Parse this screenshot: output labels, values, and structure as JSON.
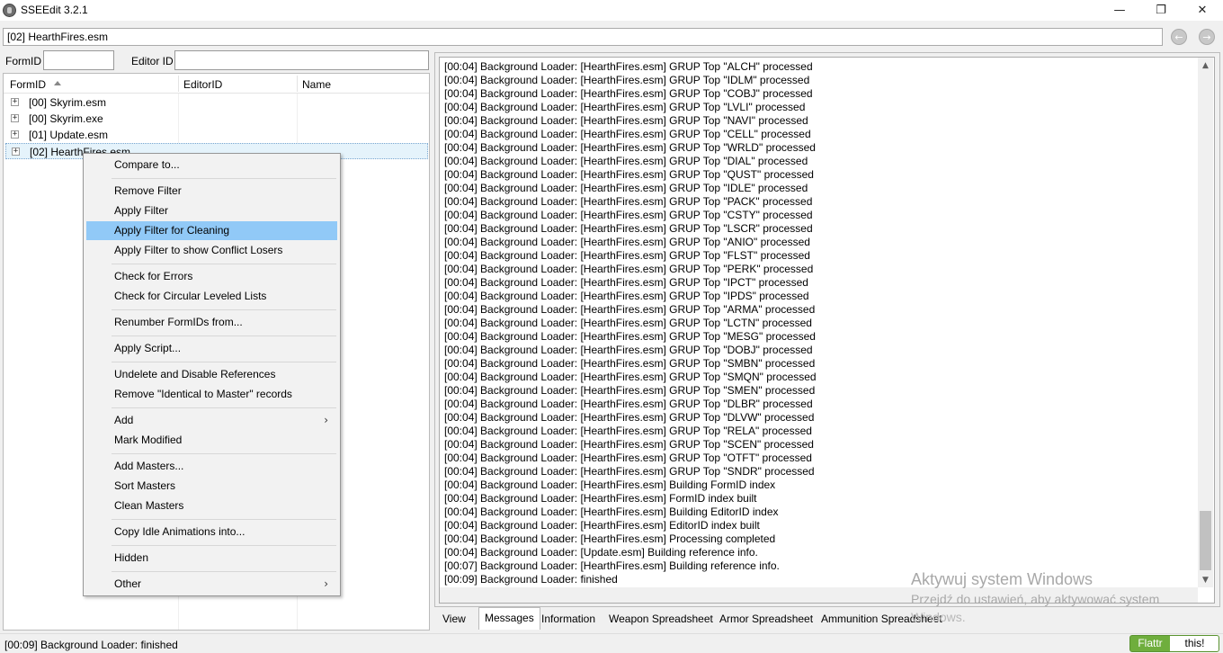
{
  "window": {
    "title": "SSEEdit 3.2.1",
    "minimize_glyph": "—",
    "maximize_glyph": "❐",
    "close_glyph": "✕"
  },
  "path_bar": {
    "value": "[02] HearthFires.esm"
  },
  "nav": {
    "back_glyph": "←",
    "forward_glyph": "→"
  },
  "filter": {
    "formid_label": "FormID",
    "formid_value": "",
    "editorid_label": "Editor ID",
    "editorid_value": ""
  },
  "tree": {
    "columns": [
      "FormID",
      "EditorID",
      "Name"
    ],
    "sort_column": "FormID",
    "sort_direction": "ascending",
    "expander_glyph": "+",
    "rows": [
      {
        "label": "[00] Skyrim.esm",
        "selected": false
      },
      {
        "label": "[00] Skyrim.exe",
        "selected": false
      },
      {
        "label": "[01] Update.esm",
        "selected": false
      },
      {
        "label": "[02] HearthFires.esm",
        "selected": true
      }
    ]
  },
  "context_menu": {
    "items": [
      {
        "label": "Compare to...",
        "separator_after": true
      },
      {
        "label": "Remove Filter"
      },
      {
        "label": "Apply Filter"
      },
      {
        "label": "Apply Filter for Cleaning",
        "highlighted": true
      },
      {
        "label": "Apply Filter to show Conflict Losers",
        "separator_after": true
      },
      {
        "label": "Check for Errors"
      },
      {
        "label": "Check for Circular Leveled Lists",
        "separator_after": true
      },
      {
        "label": "Renumber FormIDs from...",
        "separator_after": true
      },
      {
        "label": "Apply Script...",
        "separator_after": true
      },
      {
        "label": "Undelete and Disable References"
      },
      {
        "label": "Remove \"Identical to Master\" records",
        "separator_after": true
      },
      {
        "label": "Add",
        "submenu": true
      },
      {
        "label": "Mark Modified",
        "separator_after": true
      },
      {
        "label": "Add Masters..."
      },
      {
        "label": "Sort Masters"
      },
      {
        "label": "Clean Masters",
        "separator_after": true
      },
      {
        "label": "Copy Idle Animations into...",
        "separator_after": true
      },
      {
        "label": "Hidden",
        "separator_after": true
      },
      {
        "label": "Other",
        "submenu": true
      }
    ],
    "submenu_glyph": "›"
  },
  "messages": [
    "[00:04] Background Loader: [HearthFires.esm] GRUP Top \"ALCH\" processed",
    "[00:04] Background Loader: [HearthFires.esm] GRUP Top \"IDLM\" processed",
    "[00:04] Background Loader: [HearthFires.esm] GRUP Top \"COBJ\" processed",
    "[00:04] Background Loader: [HearthFires.esm] GRUP Top \"LVLI\" processed",
    "[00:04] Background Loader: [HearthFires.esm] GRUP Top \"NAVI\" processed",
    "[00:04] Background Loader: [HearthFires.esm] GRUP Top \"CELL\" processed",
    "[00:04] Background Loader: [HearthFires.esm] GRUP Top \"WRLD\" processed",
    "[00:04] Background Loader: [HearthFires.esm] GRUP Top \"DIAL\" processed",
    "[00:04] Background Loader: [HearthFires.esm] GRUP Top \"QUST\" processed",
    "[00:04] Background Loader: [HearthFires.esm] GRUP Top \"IDLE\" processed",
    "[00:04] Background Loader: [HearthFires.esm] GRUP Top \"PACK\" processed",
    "[00:04] Background Loader: [HearthFires.esm] GRUP Top \"CSTY\" processed",
    "[00:04] Background Loader: [HearthFires.esm] GRUP Top \"LSCR\" processed",
    "[00:04] Background Loader: [HearthFires.esm] GRUP Top \"ANIO\" processed",
    "[00:04] Background Loader: [HearthFires.esm] GRUP Top \"FLST\" processed",
    "[00:04] Background Loader: [HearthFires.esm] GRUP Top \"PERK\" processed",
    "[00:04] Background Loader: [HearthFires.esm] GRUP Top \"IPCT\" processed",
    "[00:04] Background Loader: [HearthFires.esm] GRUP Top \"IPDS\" processed",
    "[00:04] Background Loader: [HearthFires.esm] GRUP Top \"ARMA\" processed",
    "[00:04] Background Loader: [HearthFires.esm] GRUP Top \"LCTN\" processed",
    "[00:04] Background Loader: [HearthFires.esm] GRUP Top \"MESG\" processed",
    "[00:04] Background Loader: [HearthFires.esm] GRUP Top \"DOBJ\" processed",
    "[00:04] Background Loader: [HearthFires.esm] GRUP Top \"SMBN\" processed",
    "[00:04] Background Loader: [HearthFires.esm] GRUP Top \"SMQN\" processed",
    "[00:04] Background Loader: [HearthFires.esm] GRUP Top \"SMEN\" processed",
    "[00:04] Background Loader: [HearthFires.esm] GRUP Top \"DLBR\" processed",
    "[00:04] Background Loader: [HearthFires.esm] GRUP Top \"DLVW\" processed",
    "[00:04] Background Loader: [HearthFires.esm] GRUP Top \"RELA\" processed",
    "[00:04] Background Loader: [HearthFires.esm] GRUP Top \"SCEN\" processed",
    "[00:04] Background Loader: [HearthFires.esm] GRUP Top \"OTFT\" processed",
    "[00:04] Background Loader: [HearthFires.esm] GRUP Top \"SNDR\" processed",
    "[00:04] Background Loader: [HearthFires.esm] Building FormID index",
    "[00:04] Background Loader: [HearthFires.esm] FormID index built",
    "[00:04] Background Loader: [HearthFires.esm] Building EditorID index",
    "[00:04] Background Loader: [HearthFires.esm] EditorID index built",
    "[00:04] Background Loader: [HearthFires.esm] Processing completed",
    "[00:04] Background Loader: [Update.esm] Building reference info.",
    "[00:07] Background Loader: [HearthFires.esm] Building reference info.",
    "[00:09] Background Loader: finished"
  ],
  "scrollbar": {
    "up_glyph": "▲",
    "down_glyph": "▼"
  },
  "tabs": [
    {
      "label": "View",
      "active": false
    },
    {
      "label": "Messages",
      "active": true
    },
    {
      "label": "Information",
      "active": false
    },
    {
      "label": "Weapon Spreadsheet",
      "active": false
    },
    {
      "label": "Armor Spreadsheet",
      "active": false
    },
    {
      "label": "Ammunition Spreadsheet",
      "active": false
    }
  ],
  "watermark": {
    "line1": "Aktywuj system Windows",
    "line2": "Przejdź do ustawień, aby aktywować system",
    "line3": "Windows."
  },
  "status": {
    "text": "[00:09] Background Loader: finished"
  },
  "flattr": {
    "left": "Flattr",
    "right": "this!"
  },
  "colors": {
    "menu_highlight": "#91c9f7",
    "flattr_green": "#6fae3d",
    "selection": "#e5f3fb"
  }
}
